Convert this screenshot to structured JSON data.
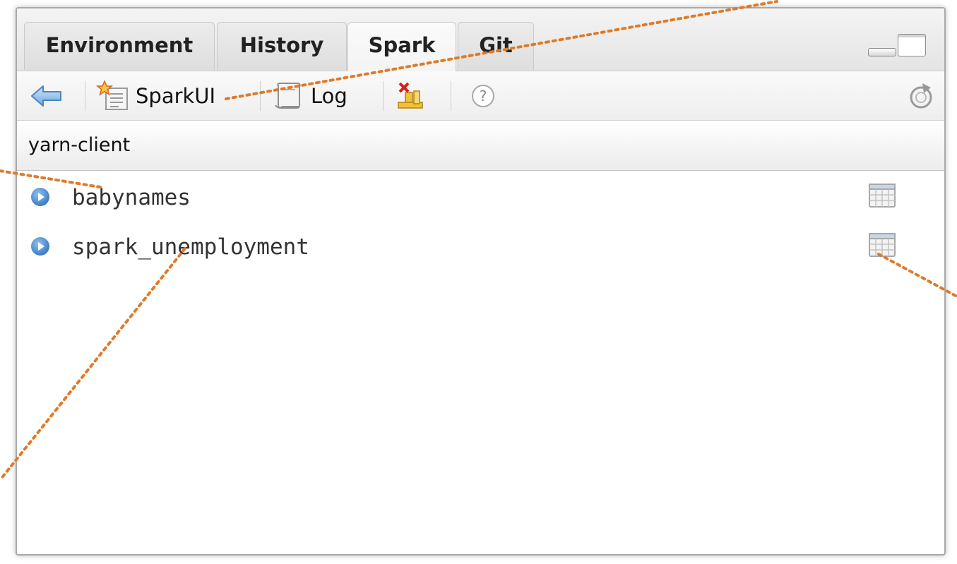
{
  "tabs": [
    {
      "label": "Environment",
      "active": false
    },
    {
      "label": "History",
      "active": false
    },
    {
      "label": "Spark",
      "active": true
    },
    {
      "label": "Git",
      "active": false
    }
  ],
  "toolbar": {
    "back_icon": "back-arrow-icon",
    "sparkui_label": "SparkUI",
    "log_label": "Log",
    "disconnect_icon": "disconnect-icon",
    "help_label": "?",
    "refresh_icon": "refresh-icon"
  },
  "connection": {
    "label": "yarn-client"
  },
  "tables": [
    {
      "name": "babynames",
      "icon": "table-grid-icon"
    },
    {
      "name": "spark_unemployment",
      "icon": "table-grid-icon"
    }
  ],
  "colors": {
    "annotation": "#e07a28",
    "expand_icon": "#3d7fc4"
  }
}
